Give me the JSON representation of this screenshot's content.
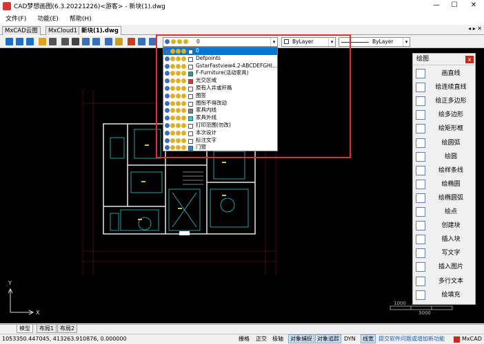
{
  "window": {
    "title": "CAD梦想画图(6.3.20221226)<游客> - 新块(1).dwg",
    "minimize": "—",
    "maximize": "☐",
    "close": "✕"
  },
  "menu": {
    "items": [
      "文件(F)",
      "功能(E)",
      "帮助(H)"
    ]
  },
  "tabs": {
    "items": [
      "MxCAD云图",
      "MxCloud1",
      "新块(1).dwg"
    ],
    "nav": "◂ ▸ ✕"
  },
  "toolbar": {
    "icons": [
      {
        "name": "new-file-icon",
        "color": "#1e6fc4"
      },
      {
        "name": "save-icon",
        "color": "#1e6fc4"
      },
      {
        "name": "save-as-icon",
        "color": "#1e6fc4"
      },
      {
        "name": "open-icon",
        "color": "#e0a020"
      },
      {
        "name": "print-icon",
        "color": "#555555"
      },
      {
        "name": "print-preview-icon",
        "color": "#555555"
      },
      {
        "name": "pan-hand-icon",
        "color": "#444444"
      },
      {
        "name": "zoom-window-icon",
        "color": "#3a6fb5"
      },
      {
        "name": "zoom-extents-icon",
        "color": "#3a6fb5"
      },
      {
        "name": "zoom-realtime-icon",
        "color": "#3a6fb5"
      },
      {
        "name": "edit-icon",
        "color": "#c8a020"
      },
      {
        "name": "match-properties-icon",
        "color": "#c84020"
      },
      {
        "name": "undo-icon",
        "color": "#3a6fb5"
      },
      {
        "name": "redo-icon",
        "color": "#3a6fb5"
      }
    ]
  },
  "layer_combo": {
    "value": "0"
  },
  "color_combo": {
    "value": "ByLayer"
  },
  "linetype_combo": {
    "value": "ByLayer"
  },
  "layer_list": {
    "items": [
      {
        "name": "0",
        "swatch": "#ffffff",
        "selected": true
      },
      {
        "name": "Defpoints",
        "swatch": "#ffffff"
      },
      {
        "name": "GstarFastview4.2-ABCDEFGHI...",
        "swatch": "#ffffff"
      },
      {
        "name": "F-Furniture(活动家具)",
        "swatch": "#2a9d8f"
      },
      {
        "name": "光交区域",
        "swatch": "#e03030"
      },
      {
        "name": "原有人井或杆路",
        "swatch": "#ffffff"
      },
      {
        "name": "图签",
        "swatch": "#ffffff"
      },
      {
        "name": "图衔不得改动",
        "swatch": "#ffffff"
      },
      {
        "name": "家具内线",
        "swatch": "#808080"
      },
      {
        "name": "家具外线",
        "swatch": "#30d0d0"
      },
      {
        "name": "打印范围(勿改)",
        "swatch": "#ffffff"
      },
      {
        "name": "本次设计",
        "swatch": "#ffffff"
      },
      {
        "name": "标注文字",
        "swatch": "#ffffff"
      },
      {
        "name": "门窗",
        "swatch": "#2a8cc8"
      }
    ]
  },
  "draw_panel": {
    "title": "绘图",
    "close": "x",
    "items": [
      {
        "label": "画直线",
        "icon": "line-icon"
      },
      {
        "label": "绘连续直线",
        "icon": "polyline-icon"
      },
      {
        "label": "绘正多边形",
        "icon": "polygon-icon"
      },
      {
        "label": "绘多边形",
        "icon": "multi-polygon-icon"
      },
      {
        "label": "绘矩形框",
        "icon": "rectangle-icon"
      },
      {
        "label": "绘圆弧",
        "icon": "arc-icon"
      },
      {
        "label": "绘圆",
        "icon": "circle-icon"
      },
      {
        "label": "绘样条线",
        "icon": "spline-icon"
      },
      {
        "label": "绘椭圆",
        "icon": "ellipse-icon"
      },
      {
        "label": "绘椭圆弧",
        "icon": "elliptical-arc-icon"
      },
      {
        "label": "绘点",
        "icon": "point-icon"
      },
      {
        "label": "创建块",
        "icon": "create-block-icon"
      },
      {
        "label": "插入块",
        "icon": "insert-block-icon"
      },
      {
        "label": "写文字",
        "icon": "text-icon"
      },
      {
        "label": "插入图片",
        "icon": "insert-image-icon"
      },
      {
        "label": "多行文本",
        "icon": "mtext-icon"
      },
      {
        "label": "绘填充",
        "icon": "hatch-icon"
      }
    ]
  },
  "scale_bar": {
    "label_1": "1000",
    "label_2": "3000"
  },
  "layout_tabs": {
    "items": [
      "模型",
      "布局1",
      "布局2"
    ]
  },
  "status": {
    "coords": "1053350.447045,  413263.910876,  0.000000",
    "toggles": [
      {
        "label": "栅格",
        "on": false
      },
      {
        "label": "正交",
        "on": false
      },
      {
        "label": "极轴",
        "on": false
      },
      {
        "label": "对象捕捉",
        "on": true
      },
      {
        "label": "对象追踪",
        "on": true
      },
      {
        "label": "DYN",
        "on": false
      },
      {
        "label": "线宽",
        "on": true
      }
    ],
    "feedback": "提交软件问题或增加新功能",
    "brand": "MxCAD"
  }
}
